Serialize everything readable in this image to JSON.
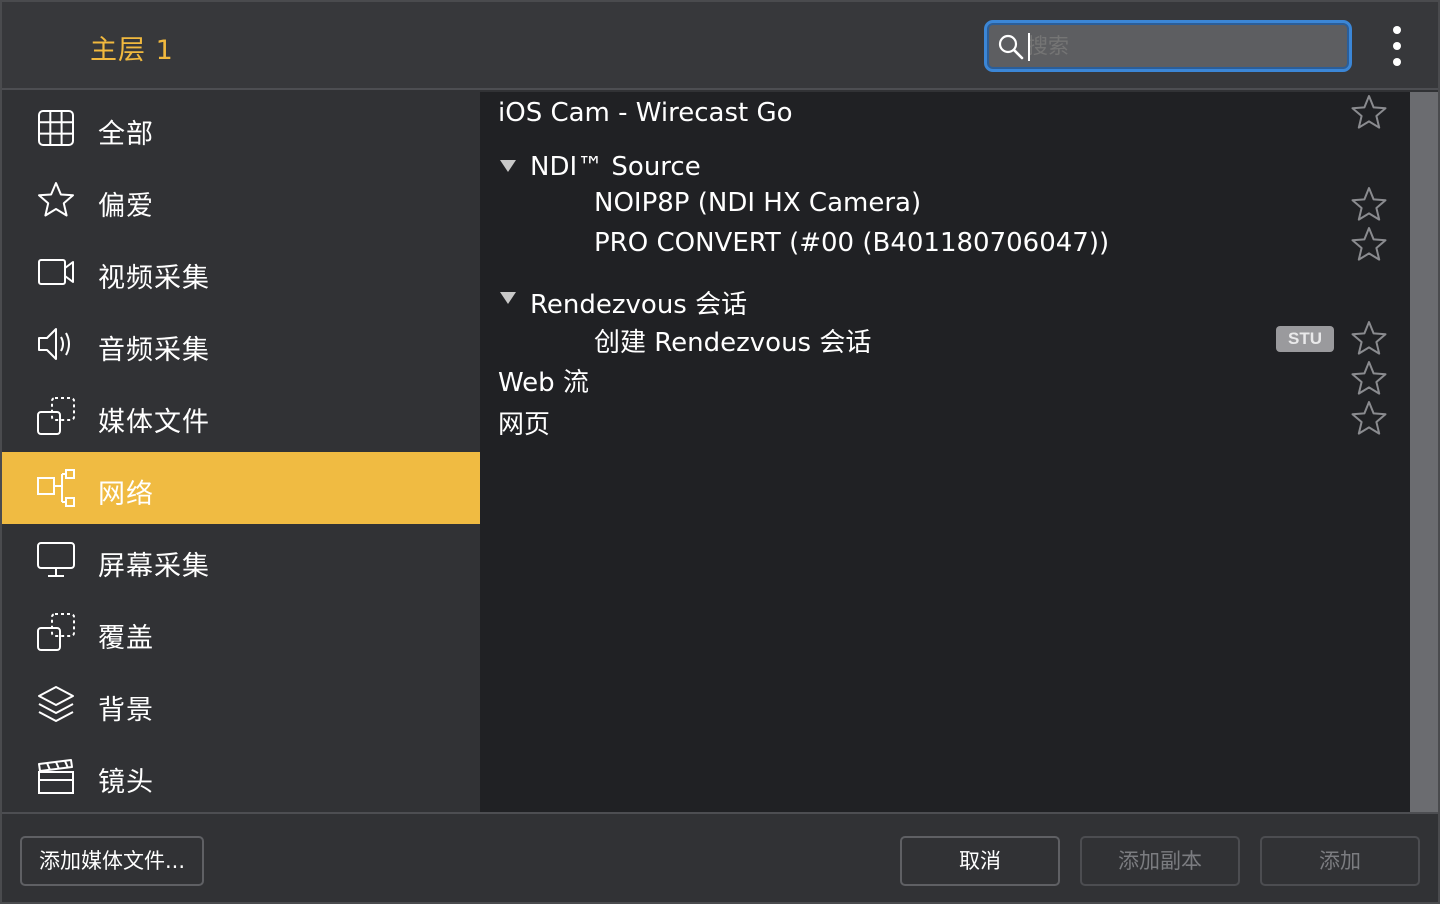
{
  "header": {
    "title": "主层 1",
    "search": {
      "placeholder": "搜索",
      "value": ""
    }
  },
  "sidebar": {
    "items": [
      {
        "label": "全部",
        "icon": "grid-icon",
        "selected": false
      },
      {
        "label": "偏爱",
        "icon": "star-icon",
        "selected": false
      },
      {
        "label": "视频采集",
        "icon": "video-camera-icon",
        "selected": false
      },
      {
        "label": "音频采集",
        "icon": "speaker-icon",
        "selected": false
      },
      {
        "label": "媒体文件",
        "icon": "media-file-icon",
        "selected": false
      },
      {
        "label": "网络",
        "icon": "network-icon",
        "selected": true
      },
      {
        "label": "屏幕采集",
        "icon": "monitor-icon",
        "selected": false
      },
      {
        "label": "覆盖",
        "icon": "overlay-icon",
        "selected": false
      },
      {
        "label": "背景",
        "icon": "layers-icon",
        "selected": false
      },
      {
        "label": "镜头",
        "icon": "clapperboard-icon",
        "selected": false
      }
    ]
  },
  "sources": {
    "ios_cam": "iOS Cam - Wirecast Go",
    "ndi_group": "NDI™ Source",
    "ndi_items": [
      "NOIP8P (NDI HX Camera)",
      "PRO CONVERT (#00 (B401180706047))"
    ],
    "rendezvous_group": "Rendezvous 会话",
    "rendezvous_item": "创建 Rendezvous 会话",
    "rendezvous_badge": "STU",
    "web_stream": "Web 流",
    "web_page": "网页"
  },
  "footer": {
    "add_media_label": "添加媒体文件...",
    "cancel_label": "取消",
    "add_copy_label": "添加副本",
    "add_label": "添加"
  },
  "colors": {
    "accent": "#f0bb42",
    "title_color": "#f1b93e",
    "search_focus": "#3b86d6",
    "list_background": "#202124",
    "sidebar_background": "#313235"
  }
}
